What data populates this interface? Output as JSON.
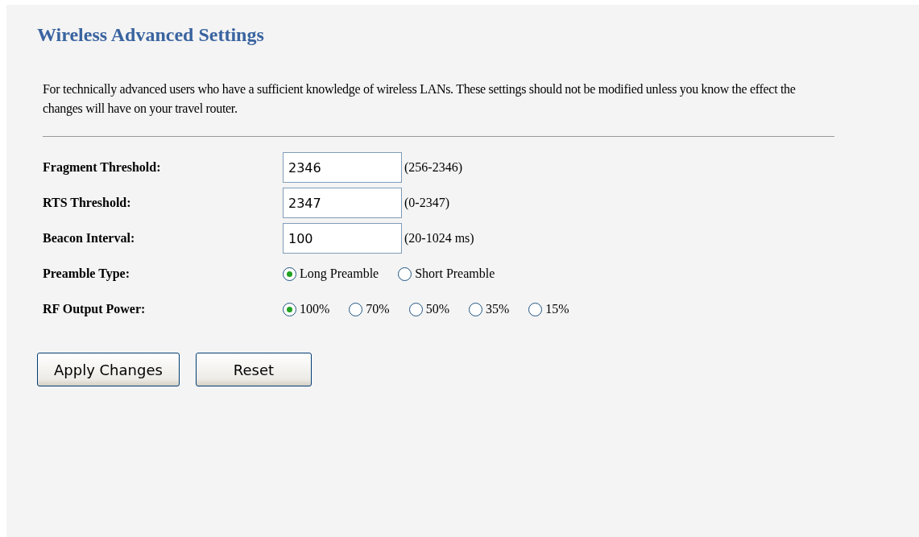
{
  "title": "Wireless Advanced Settings",
  "description": "For technically advanced users who have a sufficient knowledge of wireless LANs. These settings should not be modified unless you know the effect the changes will have on your travel router.",
  "fields": [
    {
      "kind": "text",
      "label": "Fragment Threshold:",
      "value": "2346",
      "hint": "(256-2346)"
    },
    {
      "kind": "text",
      "label": "RTS Threshold:",
      "value": "2347",
      "hint": "(0-2347)"
    },
    {
      "kind": "text",
      "label": "Beacon Interval:",
      "value": "100",
      "hint": "(20-1024 ms)"
    },
    {
      "kind": "radio",
      "label": "Preamble Type:",
      "options": [
        {
          "label": "Long Preamble",
          "selected": true
        },
        {
          "label": "Short Preamble",
          "selected": false
        }
      ]
    },
    {
      "kind": "radio",
      "label": "RF Output Power:",
      "options": [
        {
          "label": "100%",
          "selected": true
        },
        {
          "label": "70%",
          "selected": false
        },
        {
          "label": "50%",
          "selected": false
        },
        {
          "label": "35%",
          "selected": false
        },
        {
          "label": "15%",
          "selected": false
        }
      ]
    }
  ],
  "buttons": [
    "Apply Changes",
    "Reset"
  ]
}
